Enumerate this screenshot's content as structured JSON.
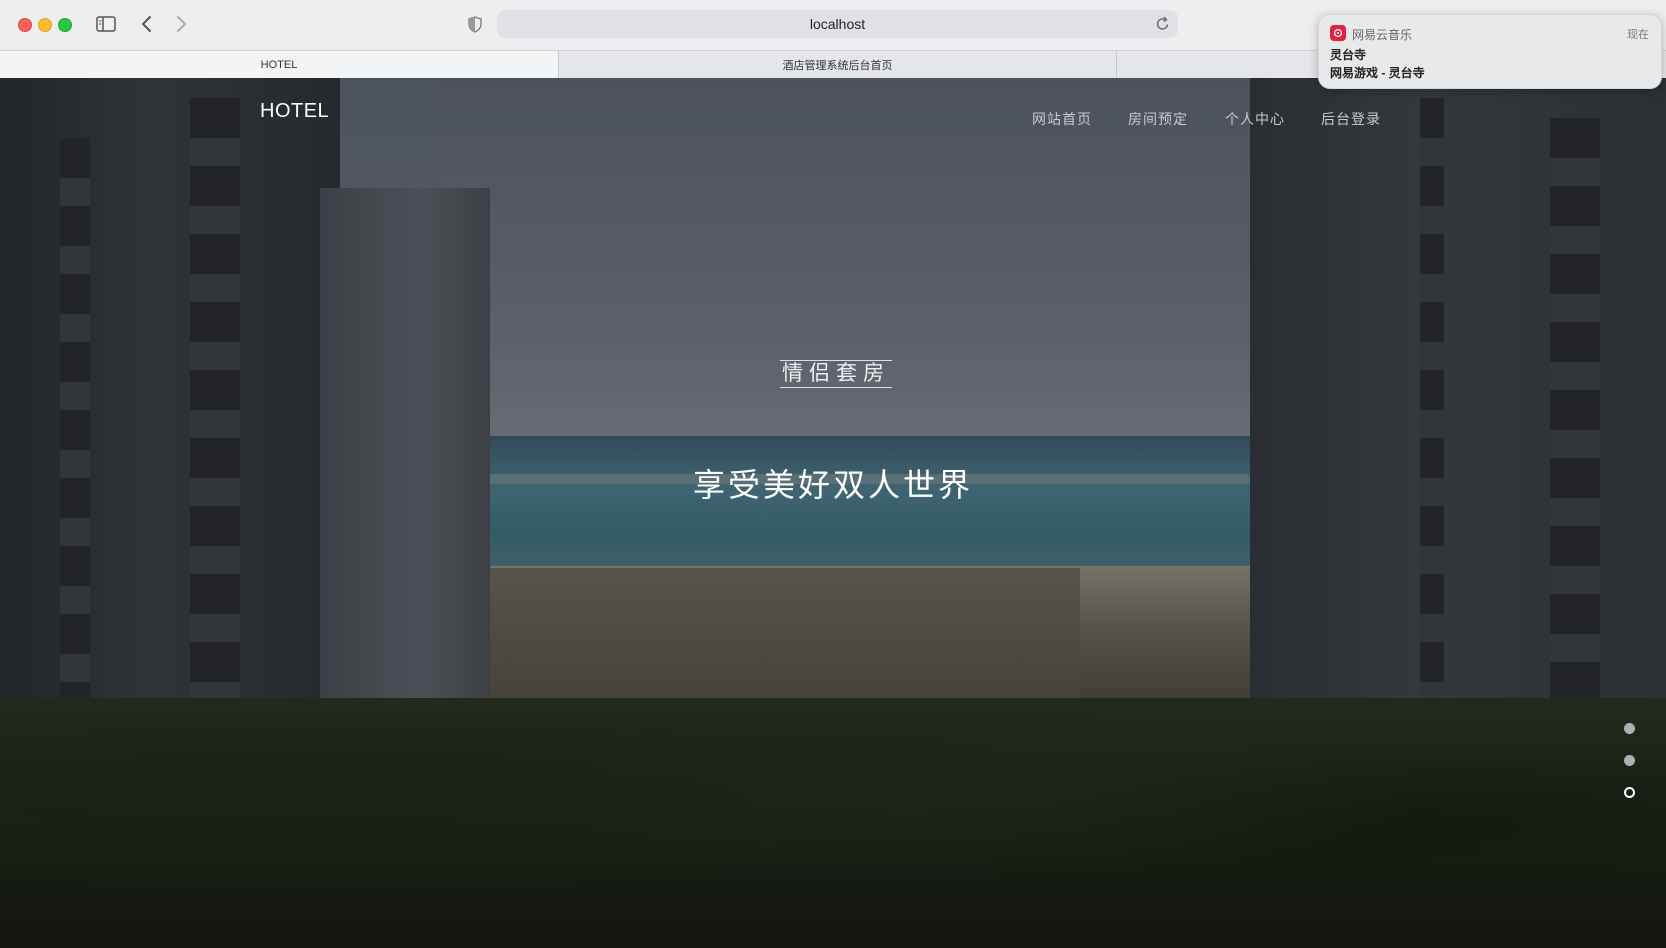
{
  "browser": {
    "url": "localhost",
    "tabs": [
      {
        "label": "HOTEL",
        "active": true
      },
      {
        "label": "酒店管理系统后台首页",
        "active": false
      },
      {
        "label": "",
        "active": false
      }
    ]
  },
  "site": {
    "brand": "HOTEL",
    "nav": [
      "网站首页",
      "房间预定",
      "个人中心",
      "后台登录"
    ]
  },
  "hero": {
    "subtitle": "情侣套房",
    "headline": "享受美好双人世界",
    "slides_total": 3,
    "active_slide": 3
  },
  "notification": {
    "app": "网易云音乐",
    "time": "现在",
    "title": "灵台寺",
    "body": "网易游戏 - 灵台寺"
  },
  "colors": {
    "notification_app_icon": "#e3223b",
    "close": "#fe5f57",
    "minimize": "#febc2e",
    "zoom": "#28c840"
  }
}
